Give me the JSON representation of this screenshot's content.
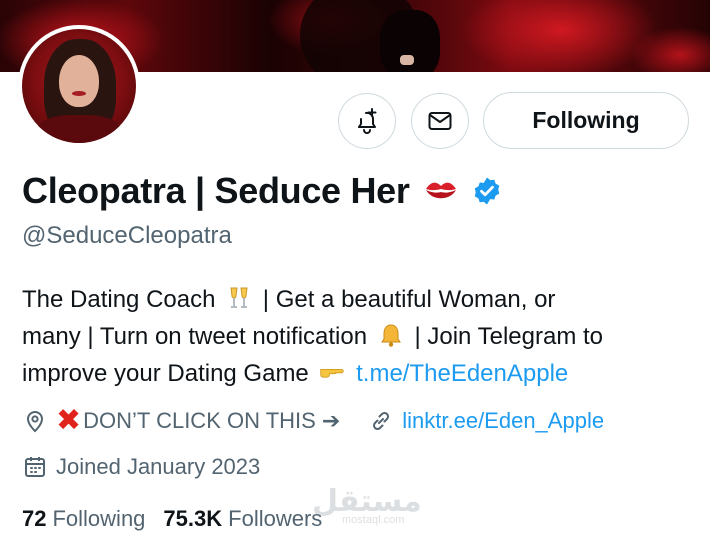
{
  "profile": {
    "display_name": "Cleopatra | Seduce Her",
    "handle": "@SeduceCleopatra",
    "verified": true,
    "bio": {
      "line1_a": "The Dating Coach",
      "line1_b": "| Get a beautiful Woman, or",
      "line2_a": "many | Turn on tweet notification",
      "line2_b": "| Join Telegram to",
      "line3_a": "improve your Dating Game",
      "link": "t.me/TheEdenApple"
    },
    "location_text": "DON’T CLICK ON THIS",
    "location_arrow": "➔",
    "website": "linktr.ee/Eden_Apple",
    "joined": "Joined January 2023"
  },
  "actions": {
    "following_label": "Following"
  },
  "stats": {
    "following_count": "72",
    "following_label": "Following",
    "followers_count": "75.3K",
    "followers_label": "Followers"
  },
  "watermark": {
    "main": "مستقل",
    "sub": "mostaql.com"
  },
  "icons": {
    "bell": "bell-plus-icon",
    "mail": "mail-icon",
    "location": "location-pin-icon",
    "link": "link-icon",
    "calendar": "calendar-icon",
    "verified": "verified-badge-icon",
    "kiss": "kiss-lips-icon"
  },
  "colors": {
    "accent": "#1d9bf0",
    "muted": "#536471",
    "text": "#0f1419",
    "warning_red": "#e0241b"
  }
}
